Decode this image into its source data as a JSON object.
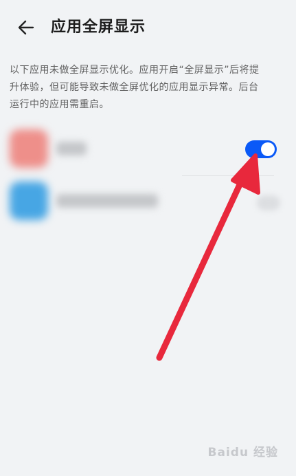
{
  "header": {
    "back_icon": "arrow-left-icon",
    "title": "应用全屏显示"
  },
  "description": {
    "line1": "以下应用未做全屏显示优化。应用开启“全屏显示”后将提",
    "line2": "升体验，但可能导致未做全屏优化的应用显示异常。后台",
    "line3": "运行中的应用需重启。"
  },
  "apps": [
    {
      "name": "",
      "icon_color": "#ee8f8a",
      "toggle_on": true,
      "toggle_color": "#0a59f7"
    },
    {
      "name": "",
      "icon_color": "#47a6e4",
      "toggle_on": false
    }
  ],
  "annotation": {
    "arrow_color": "#e8283c"
  },
  "watermark": {
    "text": "Baidu 经验"
  }
}
